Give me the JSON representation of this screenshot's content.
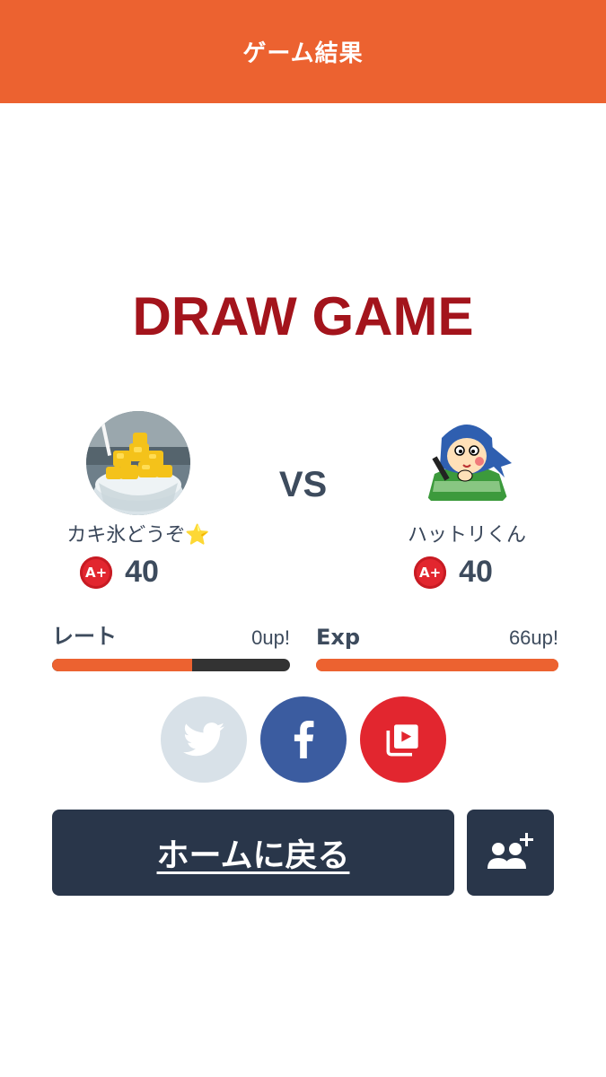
{
  "header": {
    "title": "ゲーム結果"
  },
  "result": {
    "title": "DRAW GAME",
    "vs_label": "VS"
  },
  "players": [
    {
      "name": "カキ氷どうぞ⭐",
      "rank_badge": "A+",
      "score": "40",
      "avatar": "shaved-ice-photo"
    },
    {
      "name": "ハットリくん",
      "rank_badge": "A+",
      "score": "40",
      "avatar": "ninja-character"
    }
  ],
  "stats": {
    "rate": {
      "label": "レート",
      "gain": "0up!",
      "progress_percent": 59
    },
    "exp": {
      "label": "Exp",
      "gain": "66up!",
      "progress_percent": 100
    }
  },
  "share": [
    {
      "name": "twitter",
      "icon": "twitter-bird-icon",
      "color": "#d8e1e8",
      "enabled": false
    },
    {
      "name": "facebook",
      "icon": "facebook-f-icon",
      "color": "#3b5ca0",
      "enabled": true
    },
    {
      "name": "video",
      "icon": "video-playlist-icon",
      "color": "#e2262f",
      "enabled": true
    }
  ],
  "actions": {
    "home_label": "ホームに戻る",
    "add_friend_icon": "add-friend-icon"
  },
  "colors": {
    "accent": "#ec6230",
    "title": "#a3141c",
    "dark_button": "#29364a",
    "text": "#3d4b5d"
  }
}
